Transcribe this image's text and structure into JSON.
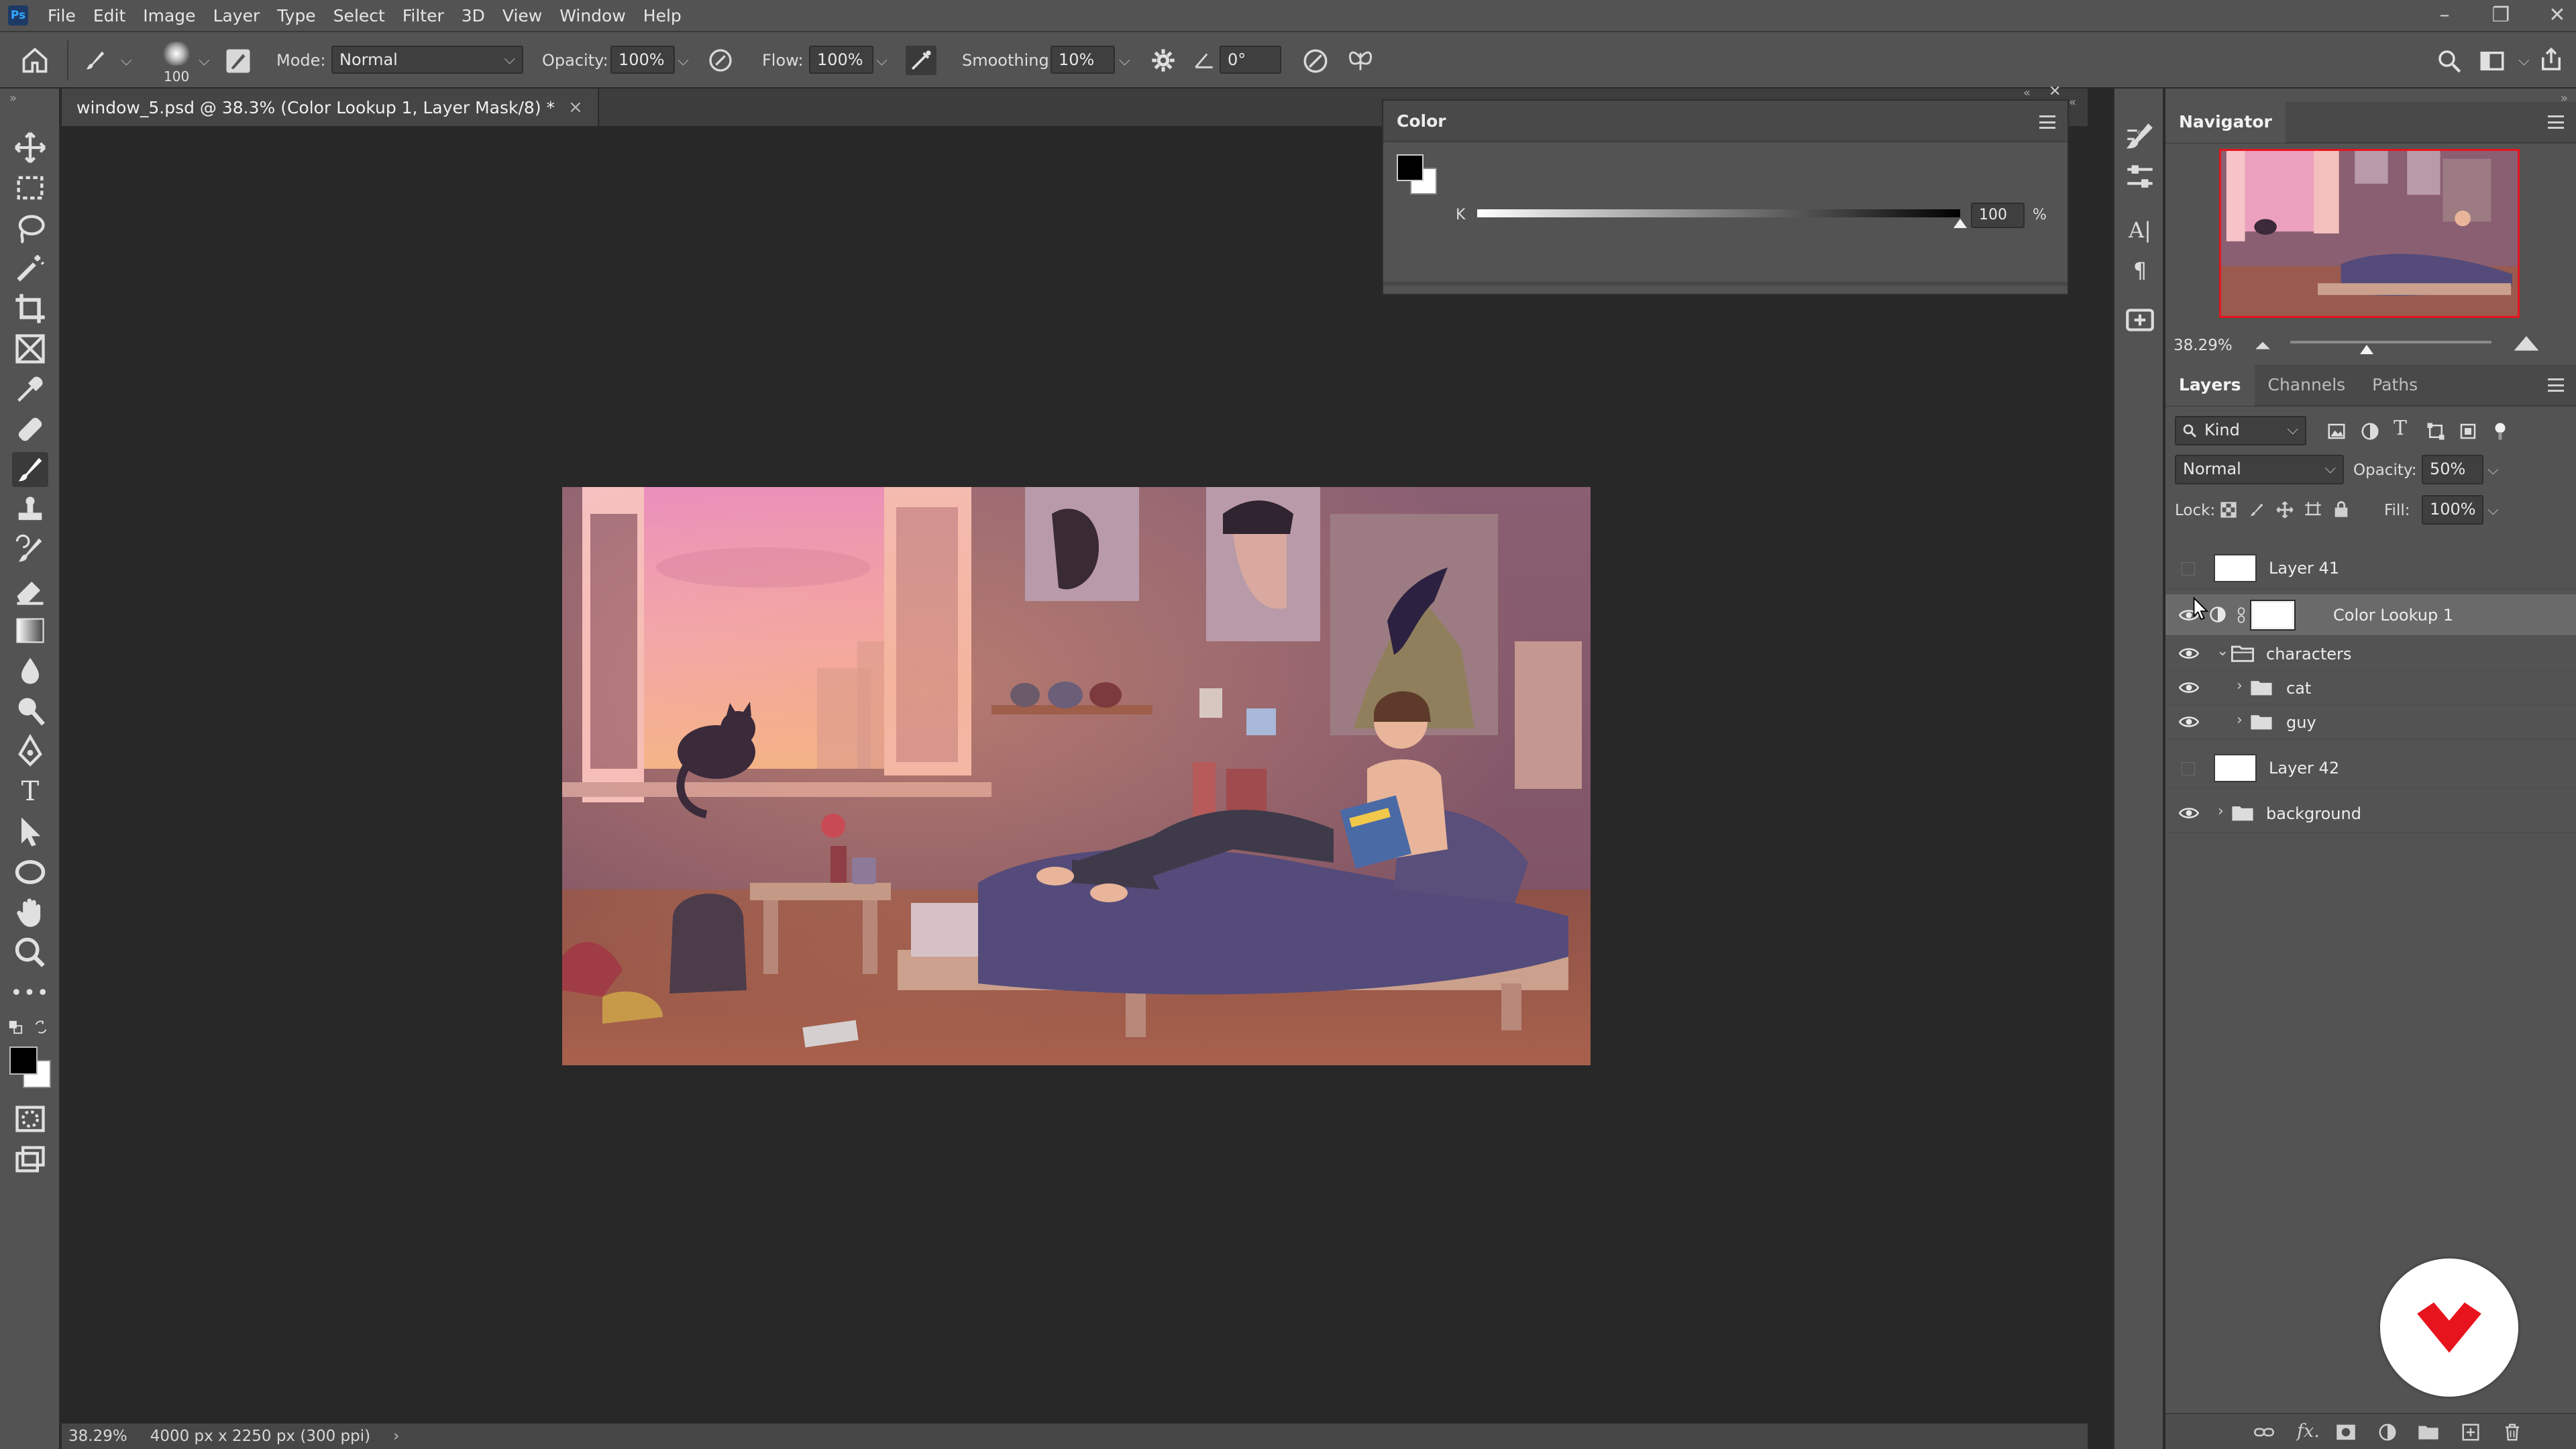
{
  "menubar": {
    "app_logo": "Ps",
    "items": [
      "File",
      "Edit",
      "Image",
      "Layer",
      "Type",
      "Select",
      "Filter",
      "3D",
      "View",
      "Window",
      "Help"
    ],
    "window_controls": [
      "–",
      "❐",
      "✕"
    ]
  },
  "options": {
    "brush_size": "100",
    "mode_label": "Mode:",
    "mode_value": "Normal",
    "opacity_label": "Opacity:",
    "opacity_value": "100%",
    "flow_label": "Flow:",
    "flow_value": "100%",
    "smoothing_label": "Smoothing:",
    "smoothing_value": "10%",
    "angle_value": "0°"
  },
  "document": {
    "tab_title": "window_5.psd @ 38.3% (Color Lookup 1, Layer Mask/8) *",
    "tab_close": "×",
    "status_zoom": "38.29%",
    "status_size": "4000 px x 2250 px (300 ppi)",
    "status_arrow": "›"
  },
  "color_panel": {
    "title": "Color",
    "channel_label": "K",
    "value": "100",
    "unit": "%",
    "slider_level": 1.0,
    "foreground": "#000000",
    "background": "#ffffff"
  },
  "navigator": {
    "title": "Navigator",
    "zoom": "38.29%",
    "zoom_slider_level": 0.38
  },
  "layers_panel": {
    "tabs": [
      "Layers",
      "Channels",
      "Paths"
    ],
    "filter_kind": "Kind",
    "blend_mode": "Normal",
    "opacity_label": "Opacity:",
    "opacity_value": "50%",
    "lock_label": "Lock:",
    "fill_label": "Fill:",
    "fill_value": "100%",
    "layers": [
      {
        "name": "Layer 41",
        "visible": false,
        "type": "pixel"
      },
      {
        "name": "Color Lookup 1",
        "visible": true,
        "type": "adjustment",
        "selected": true
      },
      {
        "name": "characters",
        "visible": true,
        "type": "group-open"
      },
      {
        "name": "cat",
        "visible": true,
        "type": "group-child"
      },
      {
        "name": "guy",
        "visible": true,
        "type": "group-child"
      },
      {
        "name": "Layer 42",
        "visible": false,
        "type": "pixel"
      },
      {
        "name": "background",
        "visible": true,
        "type": "group"
      }
    ]
  },
  "colors": {
    "accent_red": "#e8141d",
    "ps_blue": "#31a8ff"
  }
}
